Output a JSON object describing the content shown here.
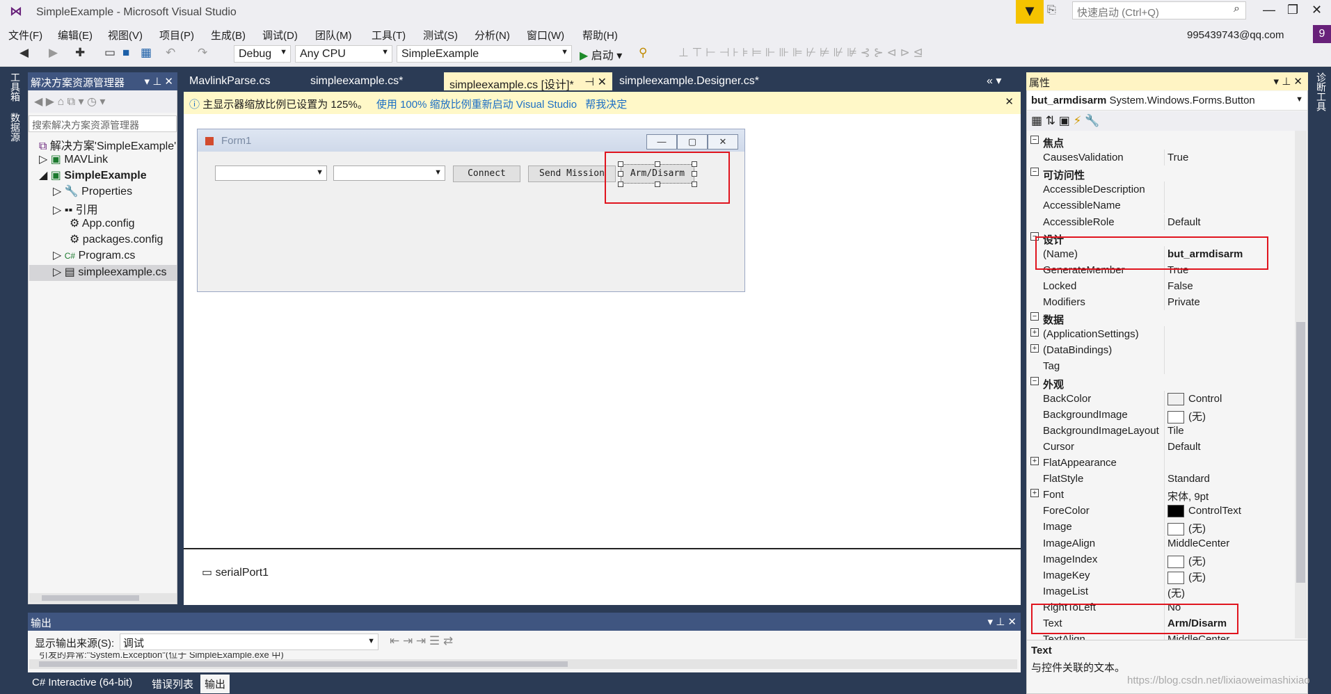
{
  "window": {
    "title": "SimpleExample - Microsoft Visual Studio",
    "quick_launch": "快速启动 (Ctrl+Q)",
    "min": "—",
    "max": "❐",
    "close": "✕"
  },
  "menu": [
    "文件(F)",
    "编辑(E)",
    "视图(V)",
    "项目(P)",
    "生成(B)",
    "调试(D)",
    "团队(M)",
    "工具(T)",
    "测试(S)",
    "分析(N)",
    "窗口(W)",
    "帮助(H)"
  ],
  "account": {
    "email": "995439743@qq.com",
    "badge": "9"
  },
  "toolbar": {
    "config": "Debug",
    "platform": "Any CPU",
    "startup": "SimpleExample",
    "run_label": "启动"
  },
  "left_strip": {
    "toolbox": "工具箱",
    "datasources": "数据源"
  },
  "right_strip": {
    "diagnostics": "诊断工具"
  },
  "solution_explorer": {
    "title": "解决方案资源管理器",
    "search_placeholder": "搜索解决方案资源管理器",
    "items": [
      {
        "label": "解决方案'SimpleExample'",
        "icon": "solution-icon"
      },
      {
        "label": "MAVLink",
        "icon": "csharp-project-icon"
      },
      {
        "label": "SimpleExample",
        "icon": "csharp-project-icon"
      },
      {
        "label": "Properties",
        "icon": "wrench-icon"
      },
      {
        "label": "引用",
        "icon": "references-icon"
      },
      {
        "label": "App.config",
        "icon": "config-file-icon"
      },
      {
        "label": "packages.config",
        "icon": "config-file-icon"
      },
      {
        "label": "Program.cs",
        "icon": "csharp-file-icon"
      },
      {
        "label": "simpleexample.cs",
        "icon": "form-file-icon"
      }
    ]
  },
  "tabs": [
    {
      "label": "MavlinkParse.cs"
    },
    {
      "label": "simpleexample.cs*"
    },
    {
      "label": "simpleexample.cs [设计]*"
    },
    {
      "label": "simpleexample.Designer.cs*"
    }
  ],
  "infobar": {
    "message": "主显示器缩放比例已设置为 125%。",
    "link1": "使用 100% 缩放比例重新启动 Visual Studio",
    "link2": "帮我决定"
  },
  "form": {
    "title": "Form1",
    "connect": "Connect",
    "send_mission": "Send Mission",
    "arm_disarm": "Arm/Disarm"
  },
  "tray": {
    "component": "serialPort1"
  },
  "output": {
    "title": "输出",
    "source_label": "显示输出来源(S):",
    "source_value": "调试",
    "truncated_line": "引发的异常:\"System.Exception\"(位于 SimpleExample.exe 中)"
  },
  "bottom_tabs": [
    "C# Interactive (64-bit)",
    "错误列表",
    "输出"
  ],
  "properties": {
    "title": "属性",
    "object_name": "but_armdisarm",
    "object_type": "System.Windows.Forms.Button",
    "rows": [
      {
        "cat": "焦点"
      },
      {
        "name": "CausesValidation",
        "value": "True"
      },
      {
        "cat": "可访问性"
      },
      {
        "name": "AccessibleDescription",
        "value": ""
      },
      {
        "name": "AccessibleName",
        "value": ""
      },
      {
        "name": "AccessibleRole",
        "value": "Default"
      },
      {
        "cat": "设计"
      },
      {
        "name": "(Name)",
        "value": "but_armdisarm",
        "bold": true
      },
      {
        "name": "GenerateMember",
        "value": "True"
      },
      {
        "name": "Locked",
        "value": "False"
      },
      {
        "name": "Modifiers",
        "value": "Private"
      },
      {
        "cat": "数据"
      },
      {
        "name": "(ApplicationSettings)",
        "value": "",
        "exp": true
      },
      {
        "name": "(DataBindings)",
        "value": "",
        "exp": true
      },
      {
        "name": "Tag",
        "value": ""
      },
      {
        "cat": "外观"
      },
      {
        "name": "BackColor",
        "value": "Control",
        "swatch": "#f0f0f0"
      },
      {
        "name": "BackgroundImage",
        "value": "(无)",
        "swatch": "#ffffff"
      },
      {
        "name": "BackgroundImageLayout",
        "value": "Tile"
      },
      {
        "name": "Cursor",
        "value": "Default"
      },
      {
        "name": "FlatAppearance",
        "value": "",
        "exp": true
      },
      {
        "name": "FlatStyle",
        "value": "Standard"
      },
      {
        "name": "Font",
        "value": "宋体, 9pt",
        "exp": true
      },
      {
        "name": "ForeColor",
        "value": "ControlText",
        "swatch": "#000000"
      },
      {
        "name": "Image",
        "value": "(无)",
        "swatch": "#ffffff"
      },
      {
        "name": "ImageAlign",
        "value": "MiddleCenter"
      },
      {
        "name": "ImageIndex",
        "value": "(无)",
        "swatch": "#ffffff"
      },
      {
        "name": "ImageKey",
        "value": "(无)",
        "swatch": "#ffffff"
      },
      {
        "name": "ImageList",
        "value": "(无)"
      },
      {
        "name": "RightToLeft",
        "value": "No"
      },
      {
        "name": "Text",
        "value": "Arm/Disarm",
        "bold": true
      },
      {
        "name": "TextAlign",
        "value": "MiddleCenter"
      }
    ],
    "desc_title": "Text",
    "desc_text": "与控件关联的文本。"
  },
  "watermark": "https://blog.csdn.net/lixiaoweimashixiao",
  "colors": {
    "accent_purple": "#68217a",
    "panel_blue": "#3f5580",
    "highlight_red": "#e0141e",
    "tab_active": "#fff4c4"
  }
}
